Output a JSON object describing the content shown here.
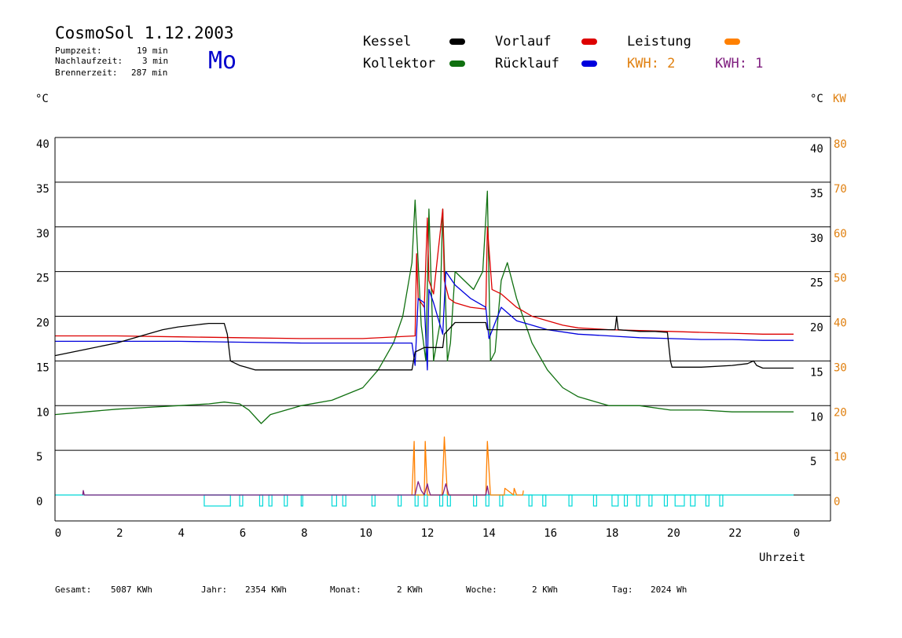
{
  "header": {
    "title": "CosmoSol 1.12.2003",
    "day": "Mo",
    "stats": [
      {
        "label": "Pumpzeit:",
        "value": "19 min"
      },
      {
        "label": "Nachlaufzeit:",
        "value": "3 min"
      },
      {
        "label": "Brennerzeit:",
        "value": "287 min"
      }
    ]
  },
  "legend": [
    {
      "label": "Kessel",
      "color": "#000000"
    },
    {
      "label": "Vorlauf",
      "color": "#dd0000"
    },
    {
      "label": "Leistung",
      "color": "#ff8000"
    },
    {
      "label": "Kollektor",
      "color": "#107010"
    },
    {
      "label": "Rücklauf",
      "color": "#0000dd"
    },
    {
      "label": "KWH: 2",
      "color": "#e08010"
    },
    {
      "label": "KWH: 1",
      "color": "#802080"
    }
  ],
  "axes": {
    "left_unit": "°C",
    "right_unit_c": "°C",
    "right_unit_kw": "KW",
    "xlabel": "Uhrzeit"
  },
  "footer": {
    "gesamt": {
      "label": "Gesamt:",
      "value": "5087 KWh"
    },
    "jahr": {
      "label": "Jahr:",
      "value": "2354 KWh"
    },
    "monat": {
      "label": "Monat:",
      "value": "2 KWh"
    },
    "woche": {
      "label": "Woche:",
      "value": "2 KWh"
    },
    "tag": {
      "label": "Tag:",
      "value": "2024 Wh"
    }
  },
  "chart_data": {
    "type": "line",
    "xlabel": "Uhrzeit",
    "ylabel": "°C",
    "xlim": [
      0,
      24
    ],
    "ylim": [
      -3,
      40
    ],
    "y2lim_kw": [
      0,
      80
    ],
    "grid": true,
    "x_ticks": [
      "0",
      "2",
      "4",
      "6",
      "8",
      "10",
      "12",
      "14",
      "16",
      "18",
      "20",
      "22",
      "0"
    ],
    "y_ticks_left": [
      "40",
      "35",
      "30",
      "25",
      "20",
      "15",
      "10",
      "5",
      "0"
    ],
    "y_ticks_right_c": [
      "40",
      "35",
      "30",
      "25",
      "20",
      "15",
      "10",
      "5"
    ],
    "y_ticks_right_kw": [
      "80",
      "70",
      "60",
      "50",
      "40",
      "30",
      "20",
      "10",
      "0"
    ],
    "series": [
      {
        "name": "Kollektor",
        "color": "#107010",
        "x": [
          0,
          1,
          2,
          3,
          4,
          5,
          5.5,
          6,
          6.3,
          6.7,
          7,
          8,
          9,
          10,
          10.5,
          11,
          11.3,
          11.6,
          11.7,
          11.9,
          12.05,
          12.15,
          12.3,
          12.5,
          12.6,
          12.75,
          12.85,
          13,
          13.3,
          13.6,
          13.9,
          14.05,
          14.15,
          14.3,
          14.5,
          14.7,
          15,
          15.5,
          16,
          16.5,
          17,
          17.5,
          18,
          19,
          20,
          21,
          22,
          23,
          24
        ],
        "y": [
          9,
          9.3,
          9.6,
          9.8,
          10,
          10.2,
          10.4,
          10.2,
          9.5,
          8,
          9,
          10,
          10.6,
          12,
          14,
          17,
          20,
          26,
          33,
          19,
          15,
          32,
          15,
          19,
          32,
          15,
          17,
          25,
          24,
          23,
          25,
          34,
          15,
          16,
          24,
          26,
          22,
          17,
          14,
          12,
          11,
          10.5,
          10,
          10,
          9.5,
          9.5,
          9.3,
          9.3,
          9.3
        ]
      },
      {
        "name": "Vorlauf",
        "color": "#dd0000",
        "x": [
          0,
          2,
          4,
          6,
          8,
          10,
          11.7,
          11.75,
          11.8,
          12,
          12.1,
          12.15,
          12.3,
          12.6,
          12.65,
          12.8,
          13,
          13.5,
          14,
          14.05,
          14.2,
          14.5,
          15,
          15.5,
          16,
          16.5,
          17,
          18,
          19,
          20,
          21,
          22,
          23,
          24
        ],
        "y": [
          17.8,
          17.8,
          17.7,
          17.6,
          17.5,
          17.5,
          17.8,
          27,
          22,
          21,
          31,
          24,
          22.5,
          32,
          24,
          22,
          21.5,
          21,
          20.8,
          30,
          23,
          22.5,
          21,
          20,
          19.5,
          19,
          18.7,
          18.5,
          18.4,
          18.3,
          18.2,
          18.1,
          18,
          18
        ]
      },
      {
        "name": "Rücklauf",
        "color": "#0000dd",
        "x": [
          0,
          2,
          4,
          6,
          8,
          10,
          11.6,
          11.7,
          11.8,
          12,
          12.1,
          12.15,
          12.3,
          12.6,
          12.7,
          13,
          13.5,
          14,
          14.1,
          14.5,
          15,
          15.5,
          16,
          17,
          18,
          19,
          20,
          21,
          22,
          23,
          24
        ],
        "y": [
          17.2,
          17.2,
          17.2,
          17.1,
          17,
          17,
          17,
          14.5,
          22,
          21.5,
          14,
          23,
          21.5,
          18,
          25,
          23.5,
          22,
          21,
          17.5,
          21,
          19.5,
          19,
          18.5,
          18,
          17.8,
          17.6,
          17.5,
          17.4,
          17.4,
          17.3,
          17.3
        ]
      },
      {
        "name": "Kessel",
        "color": "#000000",
        "x": [
          0,
          1,
          2,
          3,
          3.5,
          4,
          5,
          5.5,
          5.6,
          5.7,
          6,
          6.2,
          6.5,
          7,
          8,
          9,
          10,
          11,
          11.6,
          11.65,
          11.7,
          12,
          12.6,
          12.65,
          13,
          14,
          14.05,
          18.2,
          18.25,
          18.3,
          19,
          19.5,
          19.9,
          20,
          20.05,
          21,
          22,
          22.5,
          22.7,
          22.8,
          23,
          24
        ],
        "y": [
          15.6,
          16.3,
          17,
          18,
          18.5,
          18.8,
          19.2,
          19.2,
          18,
          15,
          14.5,
          14.3,
          14,
          14,
          14,
          14,
          14,
          14,
          14,
          15,
          16,
          16.5,
          16.5,
          18,
          19.3,
          19.3,
          18.5,
          18.5,
          20,
          18.5,
          18.3,
          18.3,
          18.2,
          15,
          14.3,
          14.3,
          14.5,
          14.7,
          15,
          14.5,
          14.2,
          14.2
        ]
      },
      {
        "name": "Leistung",
        "color": "#ff8000",
        "axis": "kw",
        "x": [
          11.6,
          11.67,
          11.7,
          11.8,
          12,
          12.03,
          12.1,
          12.5,
          12.58,
          12.65,
          12.75,
          13.9,
          14.0,
          14.05,
          14.15,
          14.6,
          14.62,
          14.9,
          14.92,
          15.0,
          15.2,
          15.22
        ],
        "y": [
          0,
          12,
          0,
          0,
          0,
          12,
          0,
          0,
          0,
          13,
          0,
          0,
          0,
          12,
          0,
          0,
          1.5,
          0,
          1.5,
          0,
          0,
          1
        ]
      },
      {
        "name": "KWH: 1",
        "color": "#802080",
        "axis": "kw",
        "x": [
          0.9,
          0.92,
          0.95,
          11.7,
          11.8,
          11.9,
          12.0,
          12.1,
          12.15,
          12.2,
          12.6,
          12.7,
          12.8,
          14.0,
          14.05,
          14.1
        ],
        "y": [
          0,
          1,
          0,
          0,
          3,
          1,
          0,
          2.5,
          1,
          0,
          0,
          2.5,
          0,
          0,
          2,
          0
        ]
      },
      {
        "name": "Pumpe",
        "color": "#00d8d8",
        "axis": "pump",
        "pulses": [
          [
            4.85,
            5.7
          ],
          [
            6.0,
            6.1
          ],
          [
            6.65,
            6.75
          ],
          [
            6.95,
            7.05
          ],
          [
            7.45,
            7.55
          ],
          [
            8.0,
            8.05
          ],
          [
            9.0,
            9.15
          ],
          [
            9.35,
            9.45
          ],
          [
            10.3,
            10.4
          ],
          [
            11.15,
            11.25
          ],
          [
            11.7,
            11.8
          ],
          [
            12.0,
            12.1
          ],
          [
            12.5,
            12.6
          ],
          [
            12.75,
            12.85
          ],
          [
            13.6,
            13.7
          ],
          [
            14.0,
            14.1
          ],
          [
            14.45,
            14.55
          ],
          [
            15.4,
            15.5
          ],
          [
            15.85,
            15.95
          ],
          [
            16.7,
            16.8
          ],
          [
            17.5,
            17.6
          ],
          [
            18.1,
            18.3
          ],
          [
            18.5,
            18.6
          ],
          [
            18.9,
            19.0
          ],
          [
            19.3,
            19.4
          ],
          [
            19.8,
            19.9
          ],
          [
            20.15,
            20.45
          ],
          [
            20.65,
            20.8
          ],
          [
            21.15,
            21.25
          ],
          [
            21.6,
            21.7
          ]
        ]
      }
    ]
  }
}
